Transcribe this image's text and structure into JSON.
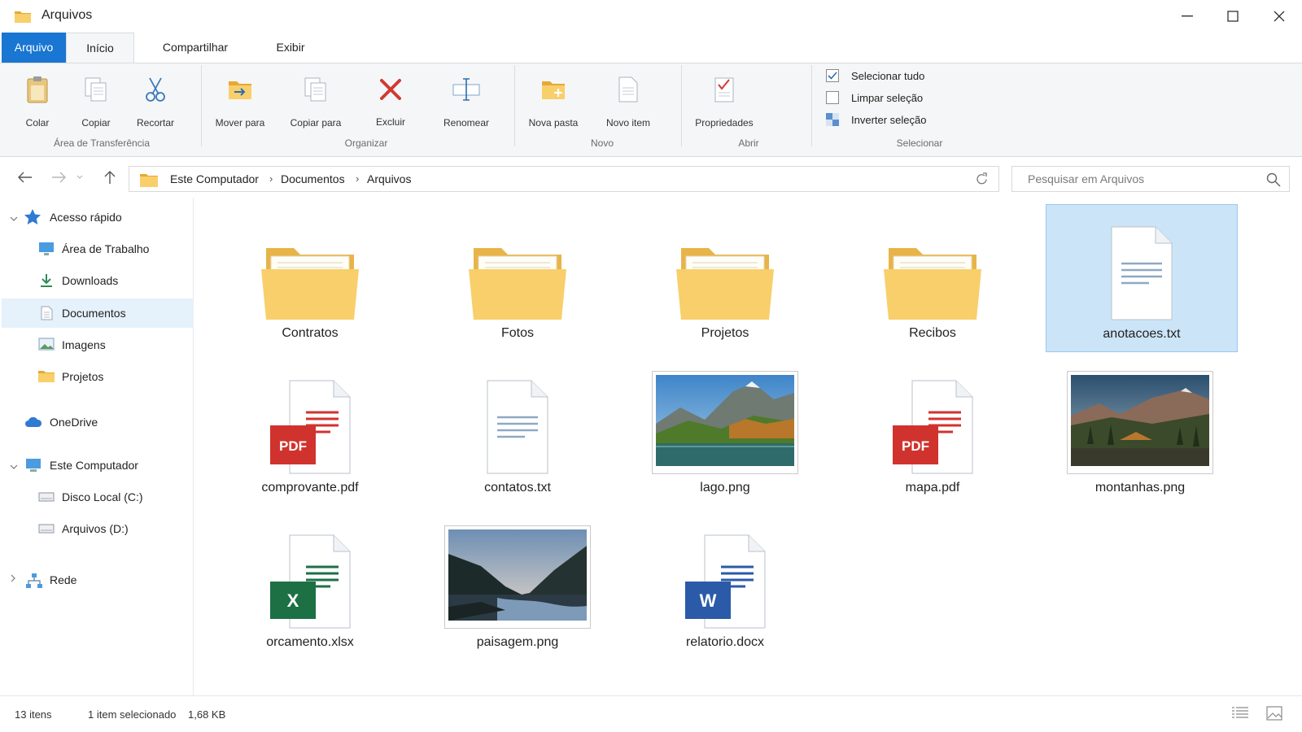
{
  "window": {
    "title": "Arquivos",
    "icon": "folder-icon"
  },
  "ribbon_tabs": {
    "file": "Arquivo",
    "home": "Início",
    "share": "Compartilhar",
    "view": "Exibir"
  },
  "ribbon": {
    "clipboard": {
      "paste": "Colar",
      "copy": "Copiar",
      "cut": "Recortar",
      "group": "Área de Transferência"
    },
    "organize": {
      "move_to": "Mover para",
      "copy_to": "Copiar para",
      "delete": "Excluir",
      "rename": "Renomear",
      "group": "Organizar"
    },
    "new": {
      "new_folder": "Nova pasta",
      "new_item": "Novo item",
      "group": "Novo"
    },
    "open": {
      "properties": "Propriedades",
      "group": "Abrir"
    },
    "select": {
      "select_all": "Selecionar tudo",
      "select_none": "Limpar seleção",
      "invert": "Inverter seleção",
      "group": "Selecionar"
    }
  },
  "address": {
    "crumbs": [
      "Este Computador",
      "Documentos",
      "Arquivos"
    ],
    "separator": "›"
  },
  "search": {
    "placeholder": "Pesquisar em Arquivos"
  },
  "nav": {
    "quick_access": "Acesso rápido",
    "desktop": "Área de Trabalho",
    "downloads": "Downloads",
    "documents": "Documentos",
    "pictures": "Imagens",
    "projects": "Projetos",
    "onedrive": "OneDrive",
    "this_pc": "Este Computador",
    "disk_c": "Disco Local (C:)",
    "disk_d": "Arquivos (D:)",
    "network": "Rede"
  },
  "files": [
    {
      "name": "Contratos",
      "type": "folder"
    },
    {
      "name": "Fotos",
      "type": "folder"
    },
    {
      "name": "Projetos",
      "type": "folder"
    },
    {
      "name": "Recibos",
      "type": "folder"
    },
    {
      "name": "anotacoes.txt",
      "type": "txt",
      "selected": true
    },
    {
      "name": "comprovante.pdf",
      "type": "pdf",
      "badge": "PDF"
    },
    {
      "name": "contatos.txt",
      "type": "txt"
    },
    {
      "name": "lago.png",
      "type": "image"
    },
    {
      "name": "mapa.pdf",
      "type": "pdf",
      "badge": "PDF"
    },
    {
      "name": "montanhas.png",
      "type": "image"
    },
    {
      "name": "orcamento.xlsx",
      "type": "xlsx",
      "badge": "X"
    },
    {
      "name": "paisagem.png",
      "type": "image"
    },
    {
      "name": "relatorio.docx",
      "type": "docx",
      "badge": "W"
    }
  ],
  "status": {
    "count": "13 itens",
    "selection": "1 item selecionado",
    "size": "1,68 KB"
  },
  "colors": {
    "accent": "#1976d2",
    "selection": "#cce4f7",
    "folder": "#f4c55c",
    "pdf": "#d0332d",
    "excel": "#1d7044",
    "word": "#2b5aa8"
  }
}
